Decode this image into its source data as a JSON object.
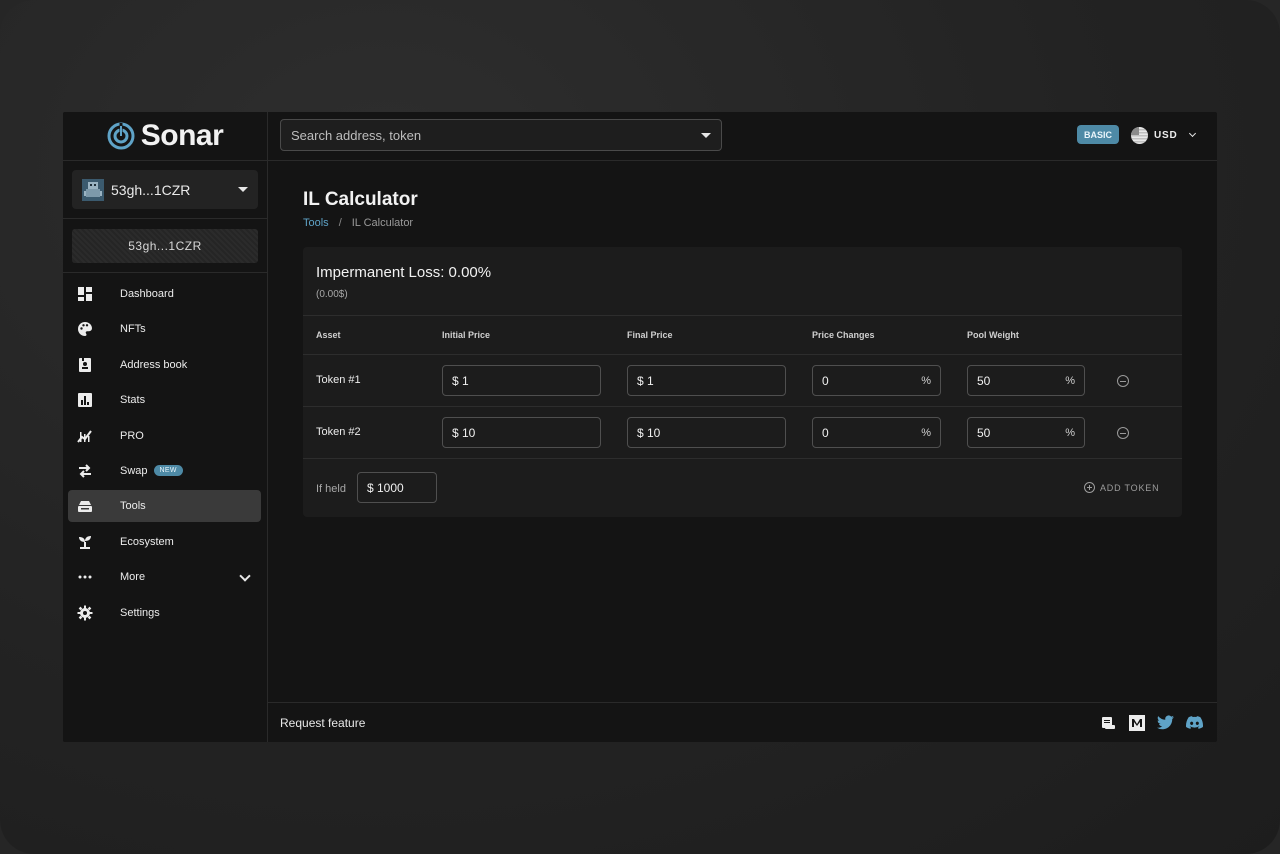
{
  "brand": {
    "name": "Sonar"
  },
  "wallet": {
    "selected": "53gh...1CZR",
    "address_pill": "53gh...1CZR"
  },
  "sidebar": {
    "items": [
      {
        "label": "Dashboard",
        "icon": "dashboard-icon"
      },
      {
        "label": "NFTs",
        "icon": "palette-icon"
      },
      {
        "label": "Address book",
        "icon": "address-book-icon"
      },
      {
        "label": "Stats",
        "icon": "stats-icon"
      },
      {
        "label": "PRO",
        "icon": "pro-chart-icon"
      },
      {
        "label": "Swap",
        "icon": "swap-icon",
        "badge": "NEW"
      },
      {
        "label": "Tools",
        "icon": "tools-icon",
        "active": true
      },
      {
        "label": "Ecosystem",
        "icon": "sprout-icon"
      },
      {
        "label": "More",
        "icon": "more-dots-icon"
      },
      {
        "label": "Settings",
        "icon": "gear-icon"
      }
    ]
  },
  "header": {
    "search_placeholder": "Search address, token",
    "plan_badge": "BASIC",
    "currency": "USD"
  },
  "page": {
    "title": "IL Calculator",
    "breadcrumb": {
      "parent": "Tools",
      "separator": "/",
      "current": "IL Calculator"
    }
  },
  "calculator": {
    "il_label": "Impermanent Loss: 0.00%",
    "il_value_sub": "(0.00$)",
    "columns": [
      "Asset",
      "Initial Price",
      "Final Price",
      "Price Changes",
      "Pool Weight"
    ],
    "rows": [
      {
        "asset": "Token #1",
        "initial_price": "$ 1",
        "final_price": "$ 1",
        "price_change": "0",
        "pool_weight": "50"
      },
      {
        "asset": "Token #2",
        "initial_price": "$ 10",
        "final_price": "$ 10",
        "price_change": "0",
        "pool_weight": "50"
      }
    ],
    "percent_unit": "%",
    "held_label": "If held",
    "held_value": "$ 1000",
    "add_token_label": "ADD TOKEN"
  },
  "footer": {
    "request_feature": "Request feature"
  },
  "colors": {
    "accent": "#4e8aa6",
    "link": "#5fa3c7",
    "background": "#141414",
    "card": "#1c1c1c"
  }
}
